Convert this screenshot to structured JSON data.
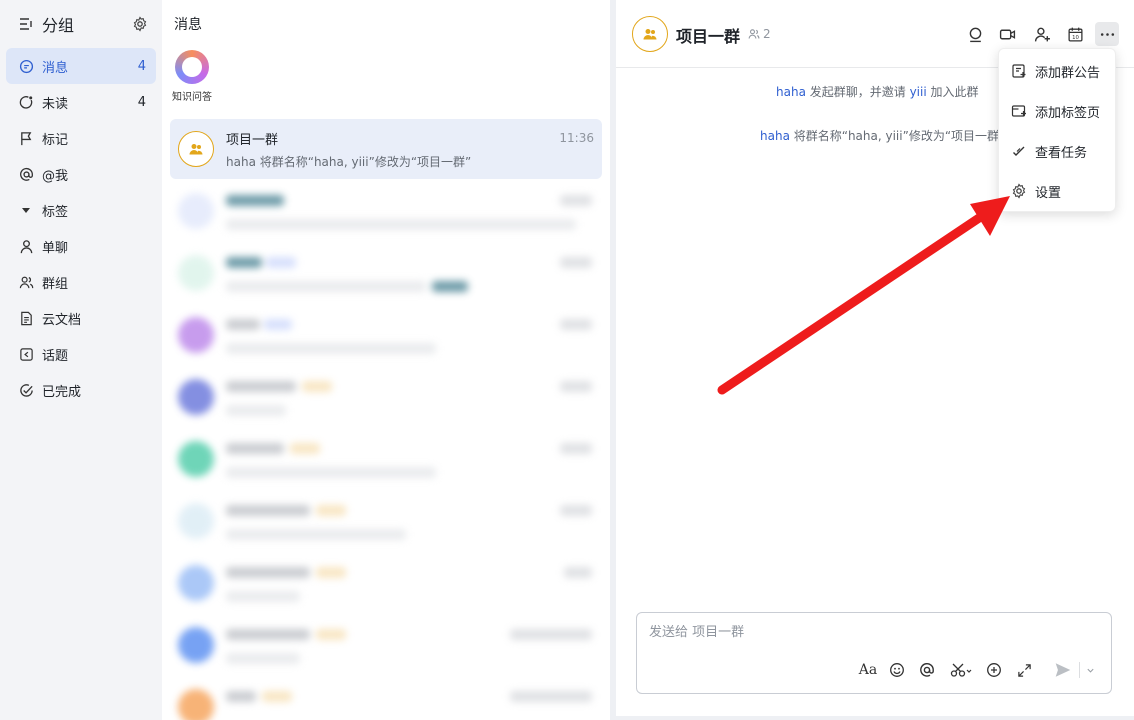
{
  "sidebar": {
    "title": "分组",
    "items": [
      {
        "label": "消息",
        "count": "4",
        "icon": "message-icon"
      },
      {
        "label": "未读",
        "count": "4",
        "icon": "unread-icon"
      },
      {
        "label": "标记",
        "count": "",
        "icon": "flag-icon"
      },
      {
        "label": "@我",
        "count": "",
        "icon": "at-icon"
      },
      {
        "label": "标签",
        "count": "",
        "icon": "caret-down-icon"
      },
      {
        "label": "单聊",
        "count": "",
        "icon": "user-icon"
      },
      {
        "label": "群组",
        "count": "",
        "icon": "group-icon"
      },
      {
        "label": "云文档",
        "count": "",
        "icon": "doc-icon"
      },
      {
        "label": "话题",
        "count": "",
        "icon": "topic-icon"
      },
      {
        "label": "已完成",
        "count": "",
        "icon": "done-icon"
      }
    ]
  },
  "list": {
    "title": "消息",
    "qa_label": "知识问答",
    "selected": {
      "name": "项目一群",
      "time": "11:36",
      "preview": "haha 将群名称“haha, yiii”修改为“项目一群”"
    }
  },
  "chat": {
    "title": "项目一群",
    "member_count": "2",
    "system_messages": [
      {
        "user": "haha",
        "text": " 发起群聊，并邀请 ",
        "user2": "yiii",
        "tail": " 加入此群"
      },
      {
        "user": "haha",
        "text": " 将群名称“haha, yiii”修改为“项目一群”"
      }
    ],
    "composer_placeholder": "发送给 项目一群"
  },
  "menu": {
    "items": [
      {
        "label": "添加群公告",
        "icon": "announcement-icon"
      },
      {
        "label": "添加标签页",
        "icon": "tab-add-icon"
      },
      {
        "label": "查看任务",
        "icon": "task-icon"
      },
      {
        "label": "设置",
        "icon": "settings-icon"
      }
    ]
  },
  "colors": {
    "accent": "#2f5fd0",
    "arrow": "#ee1c1c",
    "group_avatar": "#e2a61a"
  }
}
